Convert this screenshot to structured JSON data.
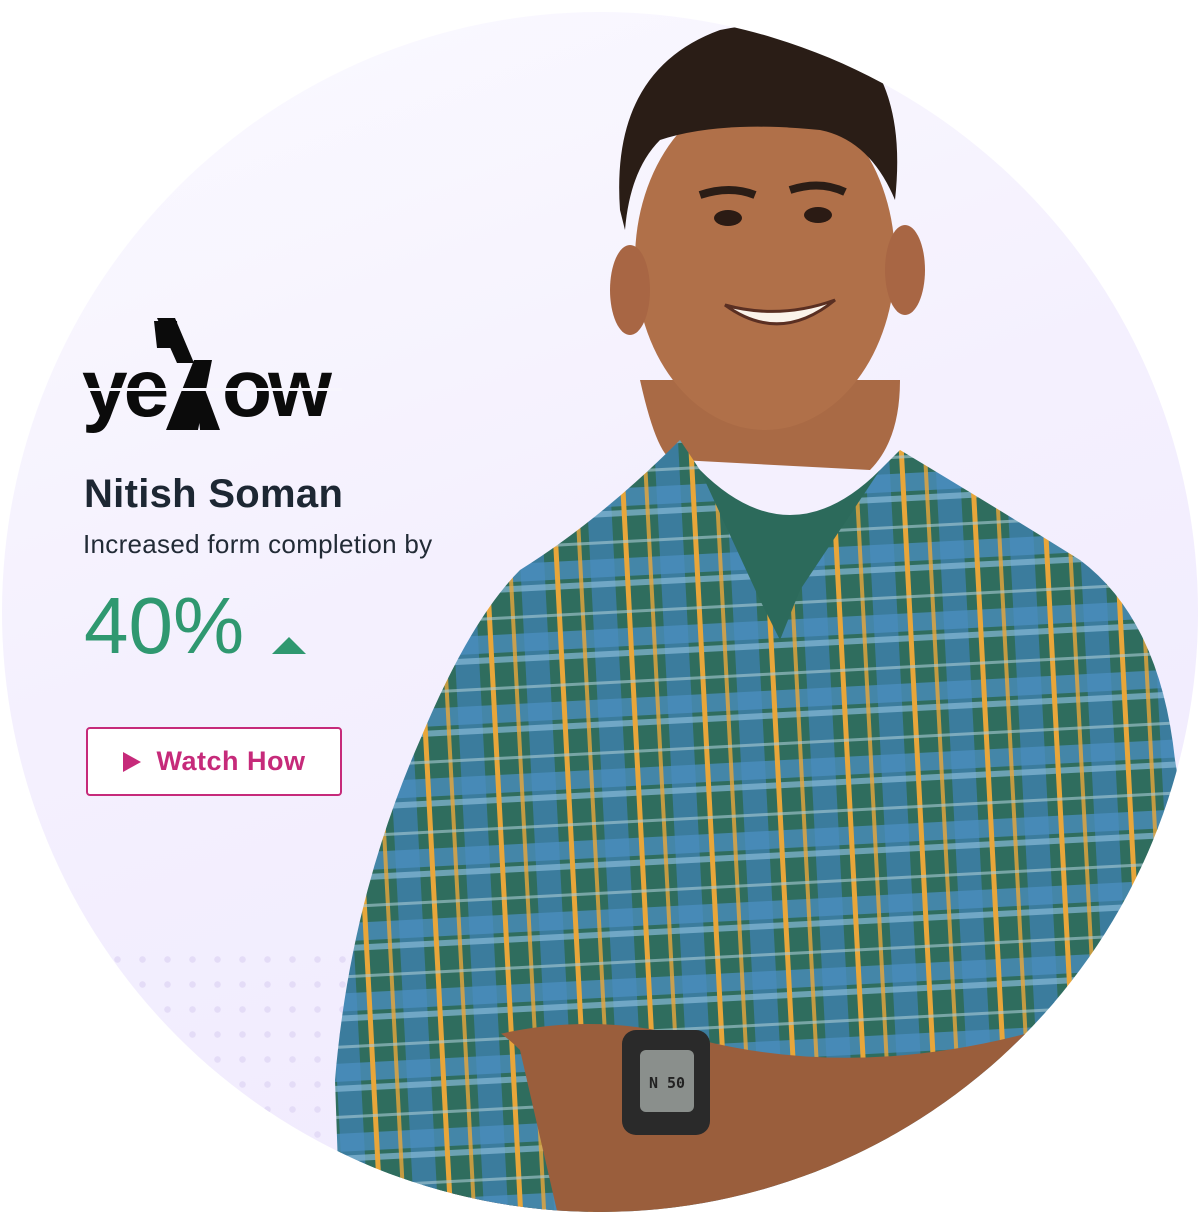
{
  "brand": {
    "logo_text": "yellow",
    "accent": "#c62a7a",
    "positive": "#2f9870"
  },
  "testimonial": {
    "name": "Nitish Soman",
    "description": "Increased form completion by",
    "stat_value": "40%",
    "stat_trend": "up",
    "cta_label": "Watch How",
    "cta_icon": "play-icon"
  },
  "photo": {
    "subject": "person-portrait",
    "watch_display": "N 50"
  }
}
